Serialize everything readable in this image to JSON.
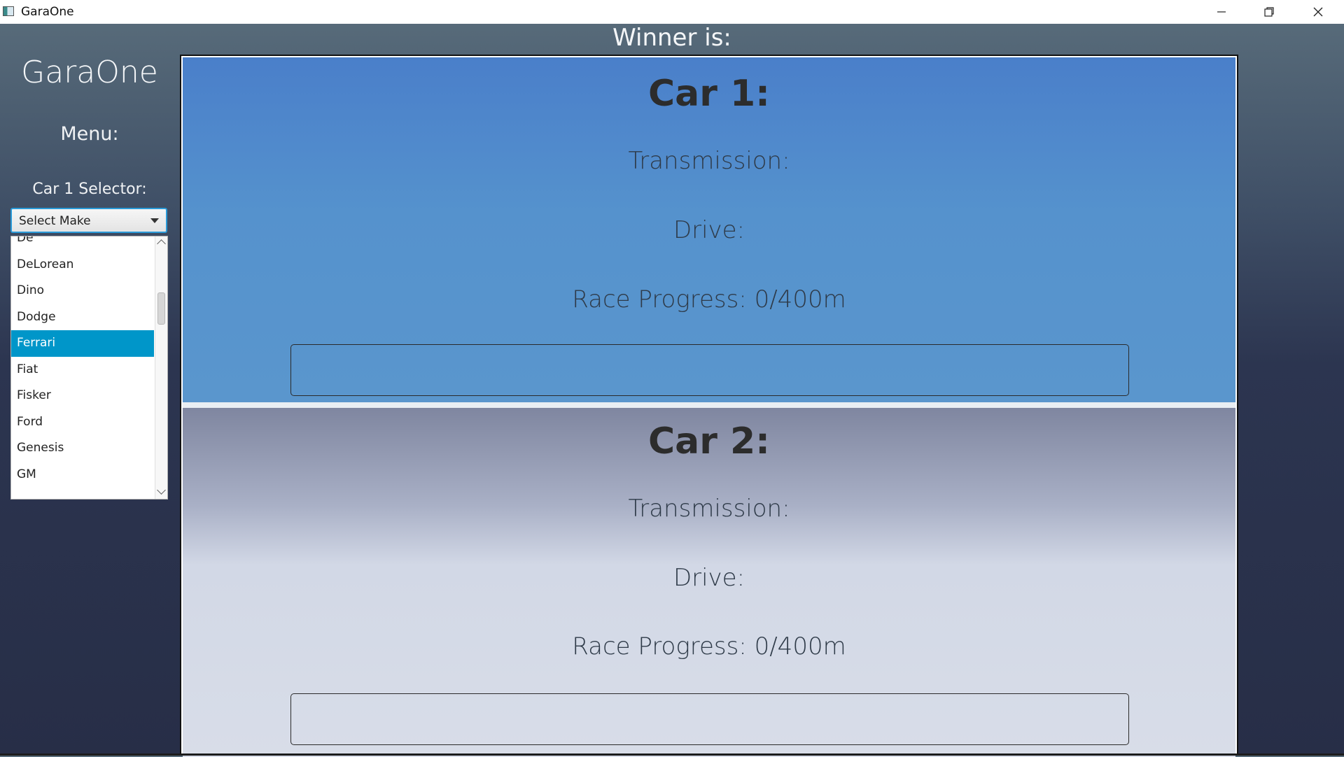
{
  "window": {
    "title": "GaraOne"
  },
  "sidebar": {
    "app_name": "GaraOne",
    "menu_label": "Menu:",
    "selector_label": "Car 1 Selector:",
    "combo_value": "Select Make",
    "dropdown_items": [
      "De",
      "DeLorean",
      "Dino",
      "Dodge",
      "Ferrari",
      "Fiat",
      "Fisker",
      "Ford",
      "Genesis",
      "GM"
    ],
    "selected_item": "Ferrari"
  },
  "winner": {
    "label": "Winner is:"
  },
  "cars": [
    {
      "title": "Car 1:",
      "transmission": "Transmission:",
      "drive": "Drive:",
      "progress_text": "Race Progress: 0/400m",
      "progress_fraction": 0,
      "panel_color": "#5592cd"
    },
    {
      "title": "Car 2:",
      "transmission": "Transmission:",
      "drive": "Drive:",
      "progress_text": "Race Progress: 0/400m",
      "progress_fraction": 0,
      "panel_color": "#d2d8e6"
    }
  ],
  "colors": {
    "selection": "#0096c9",
    "focus_border": "#2a9ad8"
  }
}
